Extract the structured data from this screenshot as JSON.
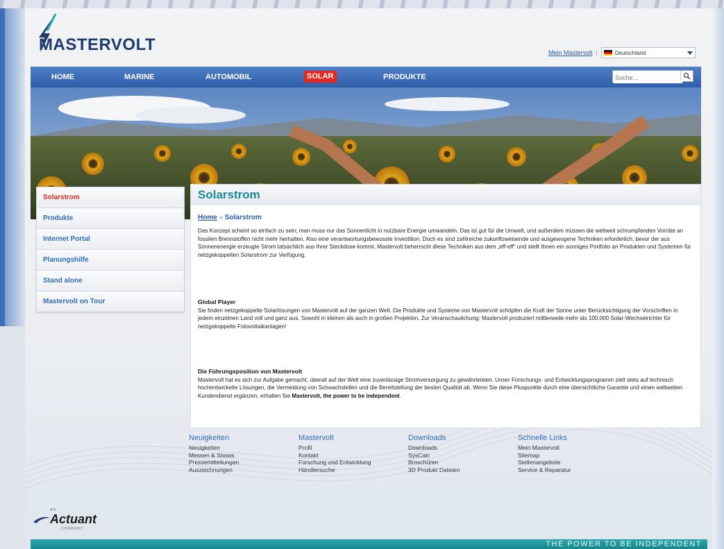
{
  "brand": {
    "name": "MASTERVOLT",
    "company": "Actuant",
    "company_prefix": "AN",
    "company_suffix": "COMPANY"
  },
  "header": {
    "account_link": "Mein Mastervolt",
    "separator": "|",
    "country": "Deutschland"
  },
  "nav": {
    "items": [
      {
        "label": "HOME"
      },
      {
        "label": "MARINE"
      },
      {
        "label": "AUTOMOBIL"
      },
      {
        "label": "SOLAR",
        "active": true
      },
      {
        "label": "PRODUKTE"
      }
    ],
    "search_placeholder": "Suche..."
  },
  "sidebar": {
    "items": [
      {
        "label": "Solarstrom",
        "active": true
      },
      {
        "label": "Produkte"
      },
      {
        "label": "Internet Portal"
      },
      {
        "label": "Planungshilfe"
      },
      {
        "label": "Stand alone"
      },
      {
        "label": "Mastervolt on Tour"
      }
    ]
  },
  "content": {
    "title": "Solarstrom",
    "breadcrumb": {
      "home": "Home",
      "separator": "»",
      "current": "Solarstrom"
    },
    "intro": "Das Konzept scheint so einfach zu sein; man muss nur das Sonnenlicht in nutzbare Energie umwandeln. Das ist gut für die Umwelt, und außerdem müssen die weltweit schrumpfenden Vorräte an fossilen Brennstoffen nicht mehr herhalten. Also eine verantwortungsbewusste Investition. Doch es sind zahlreiche zukunftsweisende und ausgewogene Techniken erforderlich, bevor der aus Sonnenenergie erzeugte Strom tatsächlich aus Ihrer Steckdose kommt. Mastervolt beherrscht diese Techniken aus dem „eff-eff“ und stellt Ihnen ein sonniges Portfolio an Produkten und Systemen für netzgekoppelten Solarstrom zur Verfügung.",
    "section1_title": "Global Player",
    "section1_text": "Sie finden netzgekoppelte Solarlösungen von Mastervolt auf der ganzen Welt. Die Produkte und Systeme von Mastervolt schöpfen die Kraft der Sonne unter Berücksichtigung der Vorschriften in jedem einzelnen Land voll und ganz aus. Sowohl in kleinen als auch in großen Projekten. Zur Veranschaulichung: Mastervolt produziert mittlerweile mehr als 100.000 Solar-Wechselrichter für netzgekoppelte Fotovoltaikanlagen!",
    "section2_title": "Die Führungsposition von Mastervolt",
    "section2_text": "Mastervolt hat es sich zur Aufgabe gemacht, überall auf der Welt eine zuverlässige Stromversorgung zu gewährleisten. Unser Forschungs- und Entwicklungsprogramm zielt stets auf technisch hochentwickelte Lösungen, die Vermeidung von Schwachstellen und die Bereitstellung der besten Qualität ab. Wenn Sie diese Pluspunkte durch eine übersichtliche Garantie und einen weltweiten Kundendienst ergänzen, erhalten Sie ",
    "section2_bold": "Mastervolt, the power to be independent",
    "section2_end": "."
  },
  "footer": {
    "columns": [
      {
        "title": "Neuigkeiten",
        "links": [
          "Neuigkeiten",
          "Messen & Shows",
          "Pressemitteilungen",
          "Auszeichnungen"
        ]
      },
      {
        "title": "Mastervolt",
        "links": [
          "Profil",
          "Kontakt",
          "Forschung und Entwicklung",
          "Händlersuche"
        ]
      },
      {
        "title": "Downloads",
        "links": [
          "Downloads",
          "SysCalc",
          "Broschüren",
          "3D Produkt Dateien"
        ]
      },
      {
        "title": "Schnelle Links",
        "links": [
          "Mein Mastervolt",
          "Sitemap",
          "Stellenangebote",
          "Service & Reparatur"
        ]
      }
    ],
    "slogan": "THE POWER TO BE INDEPENDENT"
  },
  "colors": {
    "nav_blue": "#3a6bb5",
    "active_red": "#e8261d",
    "teal": "#1b8b96",
    "link_blue": "#2e6db5"
  }
}
